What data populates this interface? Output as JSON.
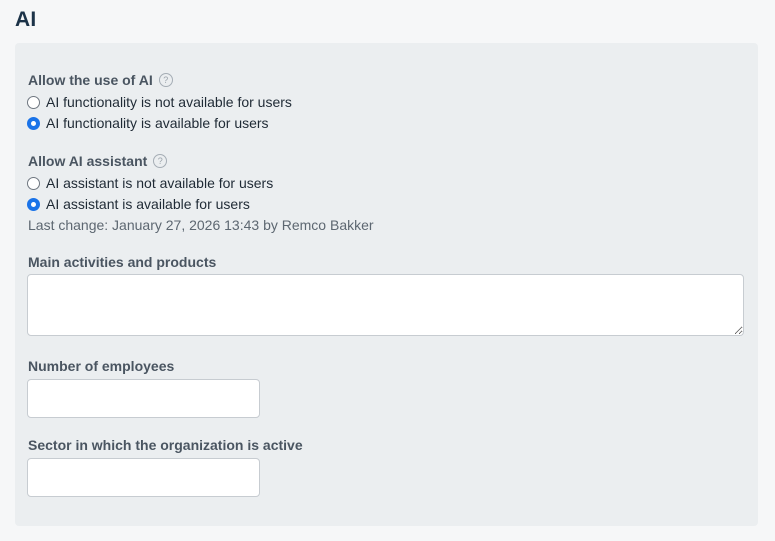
{
  "section": {
    "title": "AI"
  },
  "allow_ai": {
    "label": "Allow the use of AI",
    "help_icon": "question-circle-icon",
    "options": [
      {
        "label": "AI functionality is not available for users",
        "checked": false
      },
      {
        "label": "AI functionality is available for users",
        "checked": true
      }
    ]
  },
  "allow_assistant": {
    "label": "Allow AI assistant",
    "help_icon": "question-circle-icon",
    "options": [
      {
        "label": "AI assistant is not available for users",
        "checked": false
      },
      {
        "label": "AI assistant is available for users",
        "checked": true
      }
    ],
    "last_change": "Last change: January 27, 2026 13:43 by Remco Bakker"
  },
  "fields": {
    "activities": {
      "label": "Main activities and products",
      "value": ""
    },
    "employees": {
      "label": "Number of employees",
      "value": ""
    },
    "sector": {
      "label": "Sector in which the organization is active",
      "value": ""
    }
  },
  "colors": {
    "accent": "#1a73e8",
    "panel_bg": "#ebeef0",
    "title": "#1c3348"
  }
}
